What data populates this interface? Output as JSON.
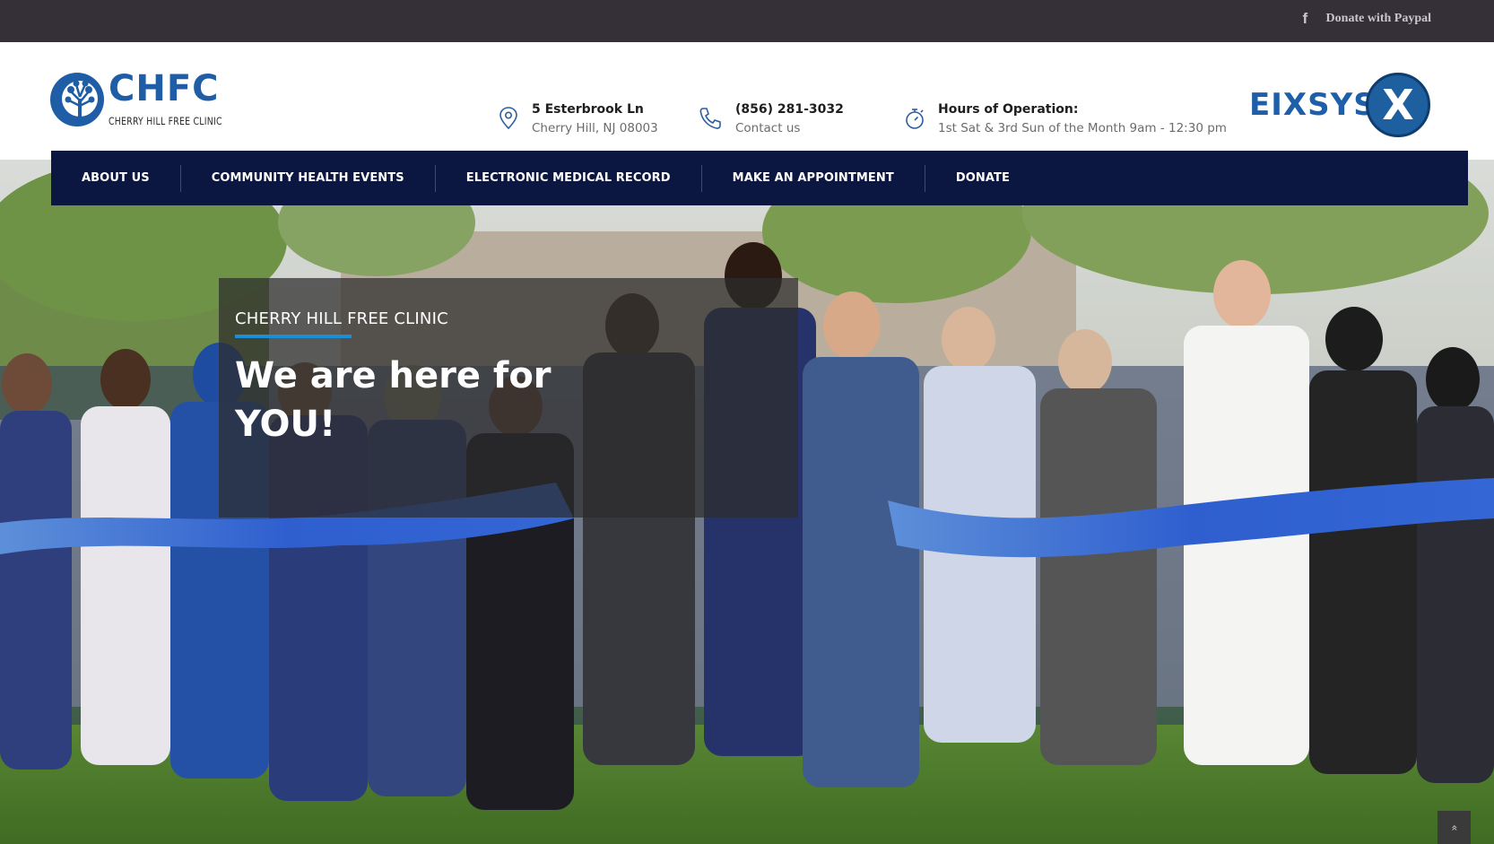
{
  "topbar": {
    "donate_label": "Donate with Paypal",
    "icon": "facebook-icon"
  },
  "logo": {
    "title": "CHFC",
    "subtitle": "CHERRY HILL FREE CLINIC"
  },
  "contact": {
    "address_title": "5 Esterbrook Ln",
    "address_sub": "Cherry Hill, NJ 08003",
    "phone_title": "(856) 281-3032",
    "phone_sub": "Contact us",
    "hours_title": "Hours of Operation:",
    "hours_sub": "1st Sat & 3rd Sun of the Month 9am - 12:30 pm"
  },
  "partner_logo": {
    "text": "EIXSYS",
    "mark": "X"
  },
  "nav": {
    "items": [
      {
        "label": "ABOUT US"
      },
      {
        "label": "COMMUNITY HEALTH EVENTS"
      },
      {
        "label": "ELECTRONIC MEDICAL RECORD"
      },
      {
        "label": "MAKE AN APPOINTMENT"
      },
      {
        "label": "DONATE"
      }
    ]
  },
  "hero": {
    "subtitle": "CHERRY HILL FREE CLINIC",
    "title": "We are here for YOU!"
  },
  "scroll_top": {
    "icon": "chevron-up-icon",
    "glyph": "»"
  },
  "colors": {
    "topbar": "#353038",
    "nav": "#0b1641",
    "brand_blue": "#1f5ea6",
    "accent_line": "#1b8ed8"
  }
}
